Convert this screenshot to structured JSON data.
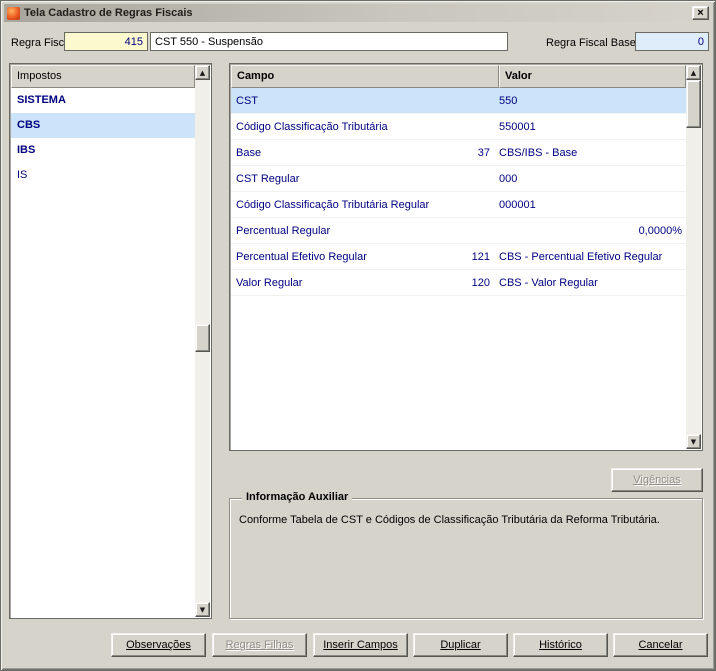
{
  "window": {
    "title": "Tela Cadastro de Regras Fiscais"
  },
  "icons": {
    "close": "×",
    "scroll_up": "▲",
    "scroll_down": "▼"
  },
  "header": {
    "regra_fiscal_label": "Regra Fiscal",
    "regra_fiscal_value": "415",
    "descricao_value": "CST 550 - Suspensão",
    "regra_fiscal_base_label": "Regra Fiscal Base",
    "regra_fiscal_base_value": "0"
  },
  "impostos": {
    "header": "Impostos",
    "items": [
      {
        "label": "SISTEMA",
        "bold": true,
        "selected": false
      },
      {
        "label": "CBS",
        "bold": true,
        "selected": true
      },
      {
        "label": "IBS",
        "bold": true,
        "selected": false
      },
      {
        "label": "IS",
        "bold": false,
        "selected": false
      }
    ]
  },
  "table": {
    "columns": {
      "campo": "Campo",
      "valor": "Valor"
    },
    "rows": [
      {
        "campo": "CST",
        "num": "",
        "desc": "550",
        "selected": true
      },
      {
        "campo": "Código Classificação Tributária",
        "num": "",
        "desc": "550001"
      },
      {
        "campo": "Base",
        "num": "37",
        "desc": "CBS/IBS - Base"
      },
      {
        "campo": "CST Regular",
        "num": "",
        "desc": "000"
      },
      {
        "campo": "Código Classificação Tributária Regular",
        "num": "",
        "desc": "000001"
      },
      {
        "campo": "Percentual Regular",
        "num": "",
        "desc": "0,0000%",
        "align": "right"
      },
      {
        "campo": "Percentual Efetivo Regular",
        "num": "121",
        "desc": "CBS - Percentual Efetivo Regular"
      },
      {
        "campo": "Valor Regular",
        "num": "120",
        "desc": "CBS - Valor Regular"
      }
    ]
  },
  "vigencias_button": {
    "label": "Vigências",
    "enabled": false
  },
  "info_box": {
    "title": "Informação Auxiliar",
    "text": "Conforme Tabela de CST e Códigos de Classificação Tributária da Reforma Tributária."
  },
  "buttons": [
    {
      "label": "Observações",
      "enabled": true
    },
    {
      "label": "Regras Filhas",
      "enabled": false
    },
    {
      "label": "Inserir Campos",
      "enabled": true
    },
    {
      "label": "Duplicar",
      "enabled": true
    },
    {
      "label": "Histórico",
      "enabled": true
    },
    {
      "label": "Cancelar",
      "enabled": true
    }
  ],
  "colors": {
    "face": "#d6d3cb",
    "selection": "#cbe4f9",
    "value_text": "#000080",
    "field_yellow": "#fcf9cf",
    "field_blue": "#dfedfb",
    "icon_orange": "#e8541e"
  }
}
